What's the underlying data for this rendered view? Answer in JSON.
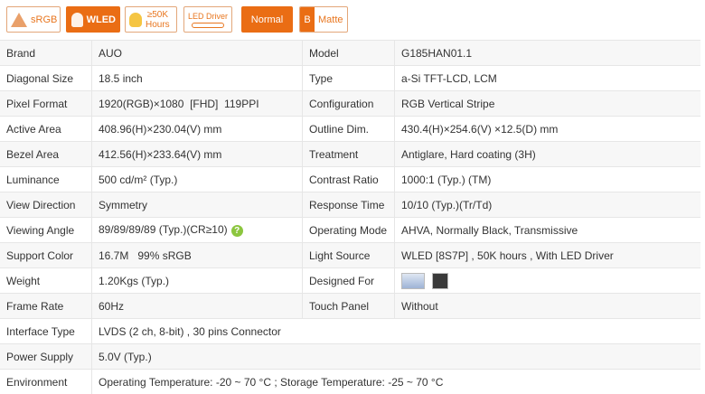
{
  "badges": {
    "srgb": "sRGB",
    "wled": "WLED",
    "hours_1": "≥50K",
    "hours_2": "Hours",
    "driver": "LED Driver",
    "normal": "Normal",
    "matte_icon": "B",
    "matte": "Matte"
  },
  "rows": [
    {
      "k1": "Brand",
      "v1": "AUO",
      "k2": "Model",
      "v2": "G185HAN01.1"
    },
    {
      "k1": "Diagonal Size",
      "v1": "18.5 inch",
      "k2": "Type",
      "v2": "a-Si TFT-LCD, LCM"
    },
    {
      "k1": "Pixel Format",
      "v1": "1920(RGB)×1080  [FHD]  119PPI",
      "k2": "Configuration",
      "v2": "RGB Vertical Stripe"
    },
    {
      "k1": "Active Area",
      "v1": "408.96(H)×230.04(V) mm",
      "k2": "Outline Dim.",
      "v2": "430.4(H)×254.6(V) ×12.5(D) mm"
    },
    {
      "k1": "Bezel Area",
      "v1": "412.56(H)×233.64(V) mm",
      "k2": "Treatment",
      "v2": "Antiglare, Hard coating (3H)"
    },
    {
      "k1": "Luminance",
      "v1": "500 cd/m² (Typ.)",
      "k2": "Contrast Ratio",
      "v2": "1000:1 (Typ.) (TM)"
    },
    {
      "k1": "View Direction",
      "v1": "Symmetry",
      "k2": "Response Time",
      "v2": "10/10 (Typ.)(Tr/Td)"
    },
    {
      "k1": "Viewing Angle",
      "v1": "89/89/89/89 (Typ.)(CR≥10)",
      "k2": "Operating Mode",
      "v2": "AHVA, Normally Black, Transmissive"
    },
    {
      "k1": "Support Color",
      "v1": "16.7M   99% sRGB",
      "k2": "Light Source",
      "v2": "WLED  [8S7P] , 50K hours , With LED Driver"
    },
    {
      "k1": "Weight",
      "v1": "1.20Kgs (Typ.)",
      "k2": "Designed For",
      "v2": ""
    },
    {
      "k1": "Frame Rate",
      "v1": "60Hz",
      "k2": "Touch Panel",
      "v2": "Without"
    },
    {
      "k1": "Interface Type",
      "v1": "LVDS (2 ch, 8-bit) , 30 pins Connector"
    },
    {
      "k1": "Power Supply",
      "v1": "5.0V (Typ.)"
    },
    {
      "k1": "Environment",
      "v1": "Operating Temperature: -20 ~ 70 °C ; Storage Temperature: -25 ~ 70 °C"
    }
  ],
  "help_icon": "?"
}
